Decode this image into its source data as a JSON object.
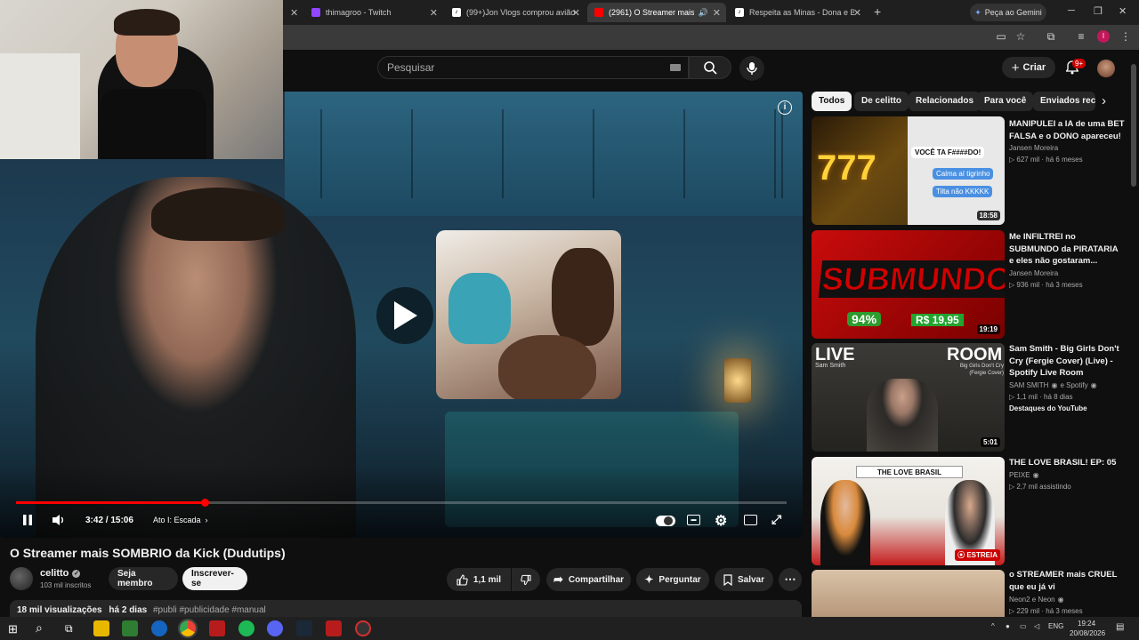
{
  "tabs": [
    {
      "label": "thimagroo - Twitch",
      "color": "#9146ff"
    },
    {
      "label": "(99+)Jon Vlogs comprou avião",
      "color": "#111111"
    },
    {
      "label": "(2961) O Streamer mais SOM",
      "color": "#ff0000"
    },
    {
      "label": "Respeita as Minas - Dona e Bia",
      "color": "#111111"
    }
  ],
  "gemini_label": "Peça ao Gemini",
  "search": {
    "placeholder": "Pesquisar"
  },
  "header": {
    "create_label": "Criar",
    "notif_badge": "9+"
  },
  "player": {
    "time": "3:42 / 15:06",
    "chapter": "Ato I: Escada",
    "progress": 0.245
  },
  "video": {
    "title": "O Streamer mais SOMBRIO da Kick (Dudutips)",
    "channel": "celitto",
    "subs": "103 mil inscritos",
    "member_label": "Seja membro",
    "subscribe_label": "Inscrever-se",
    "likes": "1,1 mil",
    "share_label": "Compartilhar",
    "ask_label": "Perguntar",
    "save_label": "Salvar",
    "views": "18 mil visualizações",
    "age": "há 2 dias",
    "tags": "#publi #publicidade #manual"
  },
  "chips": [
    "Todos",
    "De celitto",
    "Relacionados",
    "Para você",
    "Enviados rec"
  ],
  "recs": [
    {
      "title": "MANIPULEI a IA de uma BET FALSA e o DONO apareceu!",
      "channel": "Jansen Moreira",
      "meta": "627 mil · há 6 meses",
      "dur": "18:58",
      "thumb_text": "777",
      "bubble1": "VOCÊ TA F####DO!",
      "bubble2": "Calma aí tigrinho",
      "bubble3": "Tilta não KKKKK"
    },
    {
      "title": "Me INFILTREI no SUBMUNDO da PIRATARIA e eles não gostaram...",
      "channel": "Jansen Moreira",
      "meta": "936 mil · há 3 meses",
      "dur": "19:19",
      "thumb_text": "SUBMUNDO",
      "price": "R$ 19,95",
      "pct": "94%"
    },
    {
      "title": "Sam Smith - Big Girls Don't Cry (Fergie Cover) (Live) - Spotify Live Room",
      "channel": "SAM SMITH",
      "channel2": "e Spotify",
      "meta": "1,1 mil · há 8 dias",
      "extra": "Destaques do YouTube",
      "dur": "5:01",
      "thumb_left": "LIVE",
      "thumb_right": "ROOM",
      "artist": "Sam Smith",
      "subtitle": "Big Girls Don't Cry (Fergie Cover)"
    },
    {
      "title": "THE LOVE BRASIL! EP: 05",
      "channel": "PEIXE",
      "meta": "2,7 mil assistindo",
      "dur": "ESTREIA",
      "banner": "THE LOVE BRASIL"
    },
    {
      "title": "o STREAMER mais CRUEL que eu já vi",
      "channel": "Neon2 e Neon",
      "meta": "229 mil · há 3 meses"
    }
  ],
  "tray": {
    "lang": "ENG",
    "time": "19:24",
    "date": "20/08/2026"
  }
}
